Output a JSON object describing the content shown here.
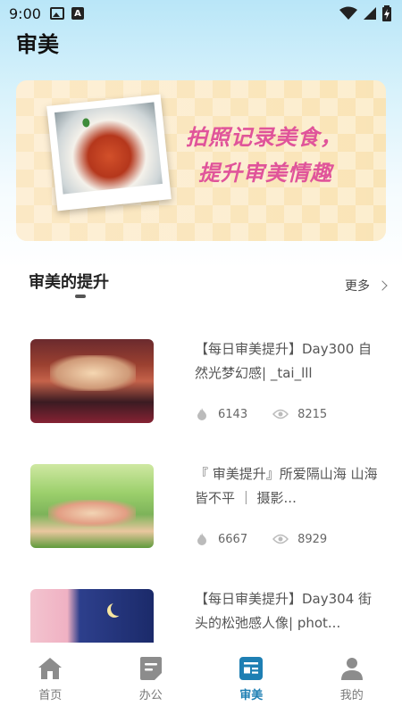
{
  "status_bar": {
    "time": "9:00",
    "icons": [
      "image-icon",
      "a-badge-icon",
      "wifi-icon",
      "signal-icon",
      "battery-charging-icon"
    ]
  },
  "header": {
    "title": "审美"
  },
  "banner": {
    "line1": "拍照记录美食，",
    "line2": "提升审美情趣"
  },
  "section": {
    "title": "审美的提升",
    "more": "更多"
  },
  "articles": [
    {
      "title": "【每日审美提升】Day300 自然光梦幻感| _tai_lll",
      "likes": "6143",
      "views": "8215"
    },
    {
      "title": "『 审美提升』所爱隔山海 山海皆不平 ｜ 摄影...",
      "likes": "6667",
      "views": "8929"
    },
    {
      "title": "【每日审美提升】Day304 街头的松弛感人像| phot...",
      "likes": "",
      "views": ""
    }
  ],
  "bottom_nav": {
    "items": [
      {
        "label": "首页",
        "icon": "home-icon"
      },
      {
        "label": "办公",
        "icon": "document-icon"
      },
      {
        "label": "审美",
        "icon": "article-icon"
      },
      {
        "label": "我的",
        "icon": "user-icon"
      }
    ],
    "active_index": 2
  },
  "colors": {
    "accent": "#1e7fb3",
    "banner_text": "#e0549a",
    "header_gradient_top": "#b9e6f8"
  }
}
